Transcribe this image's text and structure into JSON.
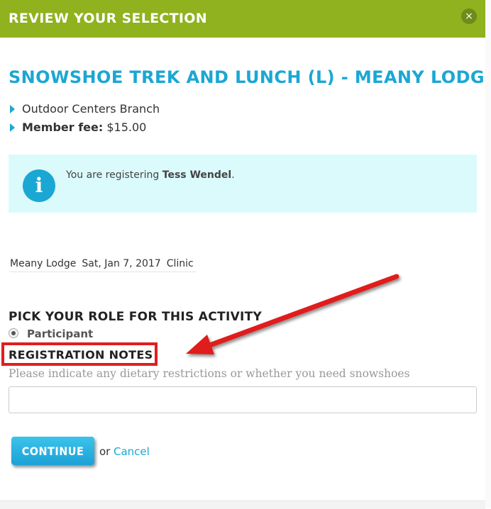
{
  "header": {
    "title": "REVIEW YOUR SELECTION",
    "close_symbol": "×"
  },
  "activity": {
    "title": "SNOWSHOE TREK AND LUNCH (L) - MEANY LODGE",
    "branch": "Outdoor Centers Branch",
    "fee_label": "Member fee:",
    "fee_value": "$15.00"
  },
  "info": {
    "icon": "info-icon",
    "prefix": "You are registering ",
    "name": "Tess Wendel",
    "suffix": "."
  },
  "session": {
    "location": "Meany Lodge",
    "date": "Sat, Jan 7, 2017",
    "type": "Clinic"
  },
  "role": {
    "heading": "PICK YOUR ROLE FOR THIS ACTIVITY",
    "option": "Participant"
  },
  "notes": {
    "heading": "REGISTRATION NOTES",
    "prompt": "Please indicate any dietary restrictions or whether you need snowshoes",
    "value": ""
  },
  "actions": {
    "continue_label": "CONTINUE",
    "or_text": "or",
    "cancel_label": "Cancel"
  },
  "colors": {
    "header_green": "#8fb21e",
    "accent_blue": "#1ba7d4",
    "info_bg": "#dbfafb",
    "annotation_red": "#e01e1e"
  }
}
